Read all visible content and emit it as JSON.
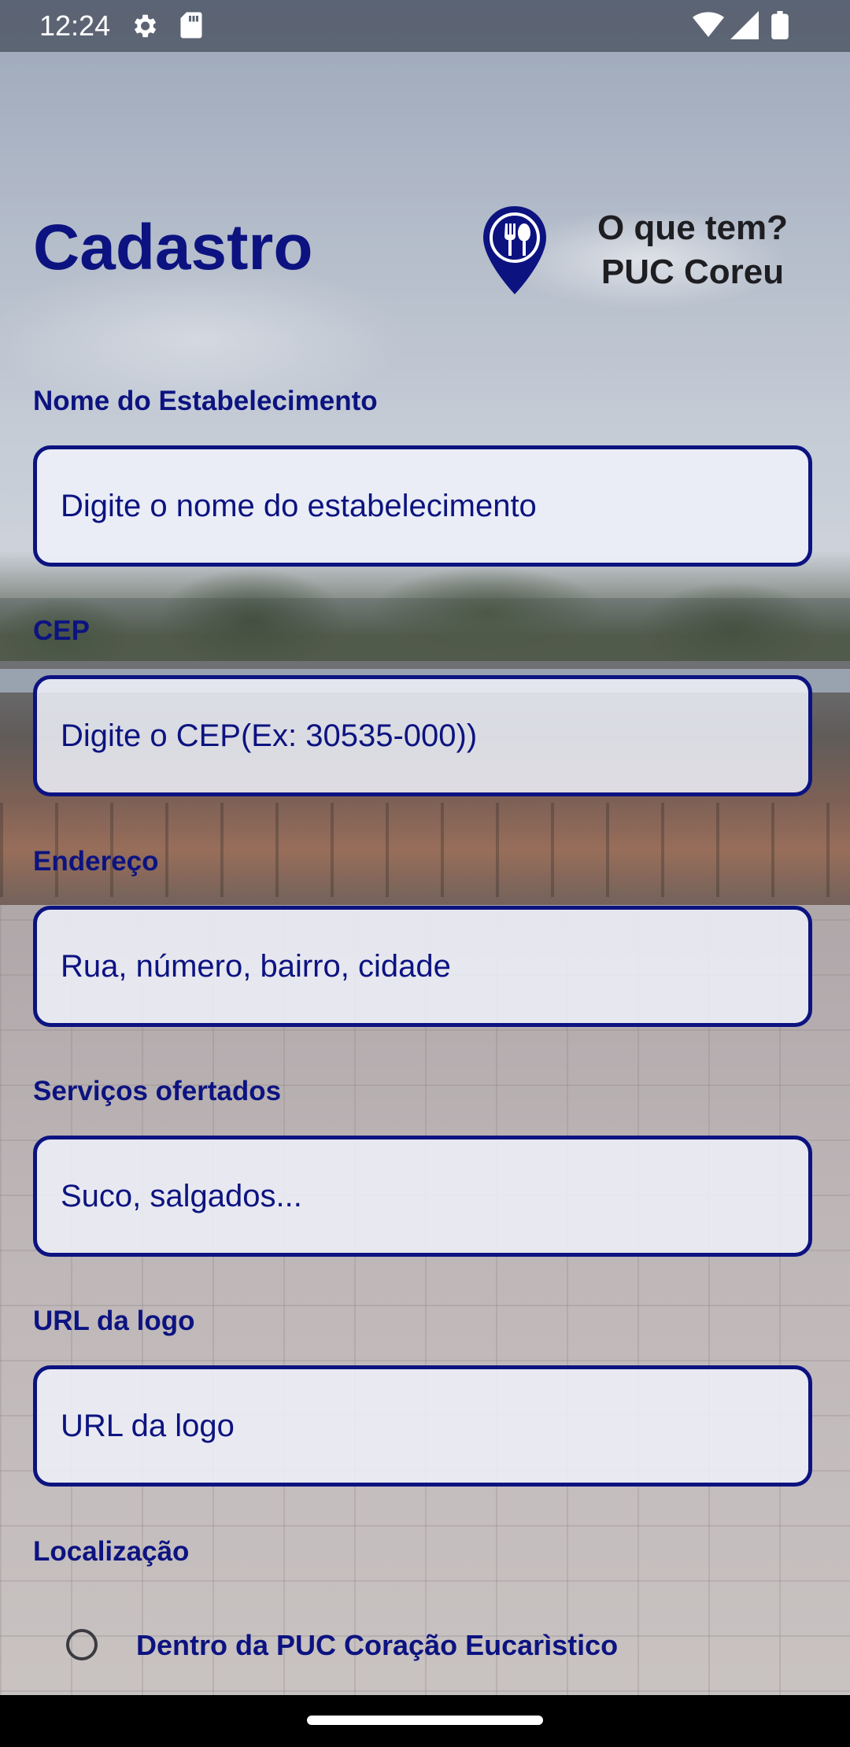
{
  "status_bar": {
    "time": "12:24",
    "icons_left": [
      "gear-icon",
      "sd-card-icon"
    ],
    "icons_right": [
      "wifi-icon",
      "signal-icon",
      "battery-icon"
    ]
  },
  "header": {
    "title": "Cadastro",
    "app_name_line1": "O que tem?",
    "app_name_line2": "PUC Coreu",
    "logo_icon": "map-pin-cutlery-icon"
  },
  "form": {
    "fields": [
      {
        "label": "Nome do Estabelecimento",
        "placeholder": "Digite o nome do estabelecimento"
      },
      {
        "label": "CEP",
        "placeholder": "Digite o CEP(Ex: 30535-000))"
      },
      {
        "label": "Endereço",
        "placeholder": "Rua, número, bairro, cidade"
      },
      {
        "label": "Serviços ofertados",
        "placeholder": "Suco, salgados..."
      },
      {
        "label": "URL da logo",
        "placeholder": "URL da logo"
      }
    ],
    "location": {
      "label": "Localização",
      "option": "Dentro da PUC Coração Eucarìstico",
      "selected": false
    }
  },
  "colors": {
    "primary": "#0c1380",
    "input_background": "#f0f2fa",
    "nav_bar": "#000000"
  }
}
